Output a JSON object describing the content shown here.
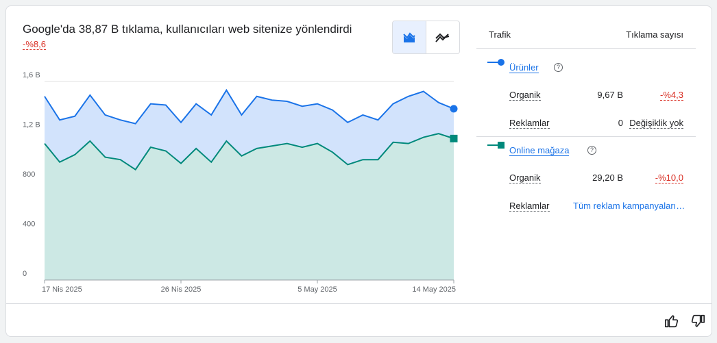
{
  "summary": {
    "headline": "Google'da 38,87 B tıklama, kullanıcıları web sitenize yönlendirdi",
    "change": "-%8,6"
  },
  "view_toggle": {
    "options": [
      {
        "icon": "area-chart-icon",
        "selected": true
      },
      {
        "icon": "line-chart-icon",
        "selected": false
      }
    ]
  },
  "colors": {
    "series1_line": "#1a73e8",
    "series1_fill": "#d2e3fc",
    "series2_line": "#00897b",
    "series2_fill": "#cce8e4",
    "negative": "#d93025",
    "link": "#1a73e8"
  },
  "chart_data": {
    "type": "area",
    "x_ticks": [
      "17 Nis 2025",
      "26 Nis 2025",
      "5 May 2025",
      "14 May 2025"
    ],
    "x_tick_index": [
      0,
      9,
      18,
      27
    ],
    "y_ticks": [
      "0",
      "400",
      "800",
      "1,2 B",
      "1,6 B"
    ],
    "y_tick_values": [
      0,
      400,
      800,
      1200,
      1600
    ],
    "ylim": [
      0,
      1600
    ],
    "grid": true,
    "series": [
      {
        "name": "Ürünler",
        "values": [
          1480,
          1290,
          1320,
          1490,
          1330,
          1290,
          1260,
          1420,
          1410,
          1270,
          1420,
          1330,
          1530,
          1330,
          1480,
          1450,
          1440,
          1400,
          1420,
          1370,
          1270,
          1330,
          1290,
          1420,
          1480,
          1520,
          1430,
          1380
        ]
      },
      {
        "name": "Online mağaza",
        "values": [
          1100,
          950,
          1010,
          1120,
          990,
          970,
          890,
          1070,
          1040,
          940,
          1060,
          950,
          1120,
          1000,
          1060,
          1080,
          1100,
          1070,
          1100,
          1030,
          930,
          970,
          970,
          1110,
          1100,
          1150,
          1180,
          1140
        ]
      }
    ]
  },
  "table": {
    "header_traffic": "Trafik",
    "header_clicks": "Tıklama sayısı",
    "groups": [
      {
        "name": "Ürünler",
        "rows": [
          {
            "label": "Organik",
            "value": "9,67 B",
            "change": "-%4,3"
          },
          {
            "label": "Reklamlar",
            "value": "0",
            "change": "Değişiklik yok"
          }
        ]
      },
      {
        "name": "Online mağaza",
        "rows": [
          {
            "label": "Organik",
            "value": "29,20 B",
            "change": "-%10,0"
          },
          {
            "label": "Reklamlar",
            "link": "Tüm reklam kampanyalarını görüntüle"
          }
        ]
      }
    ]
  },
  "footer": {
    "icons": [
      "thumb-up-icon",
      "thumb-down-icon"
    ]
  }
}
